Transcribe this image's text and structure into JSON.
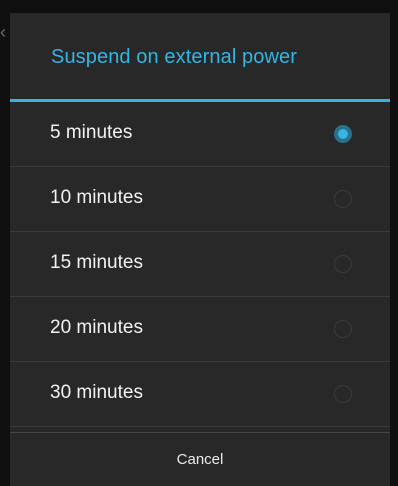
{
  "dialog": {
    "title": "Suspend on external power",
    "options": [
      {
        "label": "5 minutes",
        "selected": true
      },
      {
        "label": "10 minutes",
        "selected": false
      },
      {
        "label": "15 minutes",
        "selected": false
      },
      {
        "label": "20 minutes",
        "selected": false
      },
      {
        "label": "30 minutes",
        "selected": false
      }
    ],
    "cancel_label": "Cancel"
  },
  "colors": {
    "accent": "#33b5e5",
    "dialog_background": "#282828"
  },
  "icons": {
    "back": "chevron-left-icon",
    "radio_on": "radio-checked-icon",
    "radio_off": "radio-unchecked-icon"
  }
}
